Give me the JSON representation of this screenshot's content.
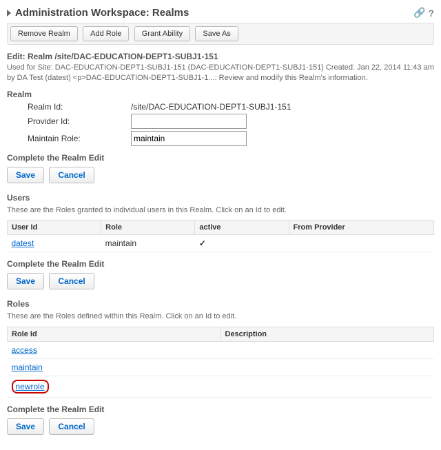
{
  "header": {
    "title": "Administration Workspace: Realms",
    "link_icon": "🔗",
    "help_icon": "?"
  },
  "toolbar": {
    "remove": "Remove Realm",
    "add_role": "Add Role",
    "grant": "Grant Ability",
    "save_as": "Save As"
  },
  "edit": {
    "title": "Edit: Realm /site/DAC-EDUCATION-DEPT1-SUBJ1-151",
    "desc": "Used for Site: DAC-EDUCATION-DEPT1-SUBJ1-151 (DAC-EDUCATION-DEPT1-SUBJ1-151) Created: Jan 22, 2014 11:43 am by DA Test (datest) <p>DAC-EDUCATION-DEPT1-SUBJ1-1...: Review and modify this Realm's information."
  },
  "realm": {
    "heading": "Realm",
    "id_label": "Realm Id:",
    "id_value": "/site/DAC-EDUCATION-DEPT1-SUBJ1-151",
    "provider_label": "Provider Id:",
    "provider_value": "",
    "maintain_label": "Maintain Role:",
    "maintain_value": "maintain"
  },
  "complete": "Complete the Realm Edit",
  "buttons": {
    "save": "Save",
    "cancel": "Cancel"
  },
  "users": {
    "heading": "Users",
    "desc": "These are the Roles granted to individual users in this Realm. Click on an Id to edit.",
    "cols": {
      "id": "User Id",
      "role": "Role",
      "active": "active",
      "from": "From Provider"
    },
    "rows": [
      {
        "id": "datest",
        "role": "maintain",
        "active": "✓",
        "from": ""
      }
    ]
  },
  "roles": {
    "heading": "Roles",
    "desc": "These are the Roles defined within this Realm. Click on an Id to edit.",
    "cols": {
      "id": "Role Id",
      "desc": "Description"
    },
    "rows": [
      {
        "id": "access",
        "desc": "",
        "hl": false
      },
      {
        "id": "maintain",
        "desc": "",
        "hl": false
      },
      {
        "id": "newrole",
        "desc": "",
        "hl": true
      }
    ]
  }
}
